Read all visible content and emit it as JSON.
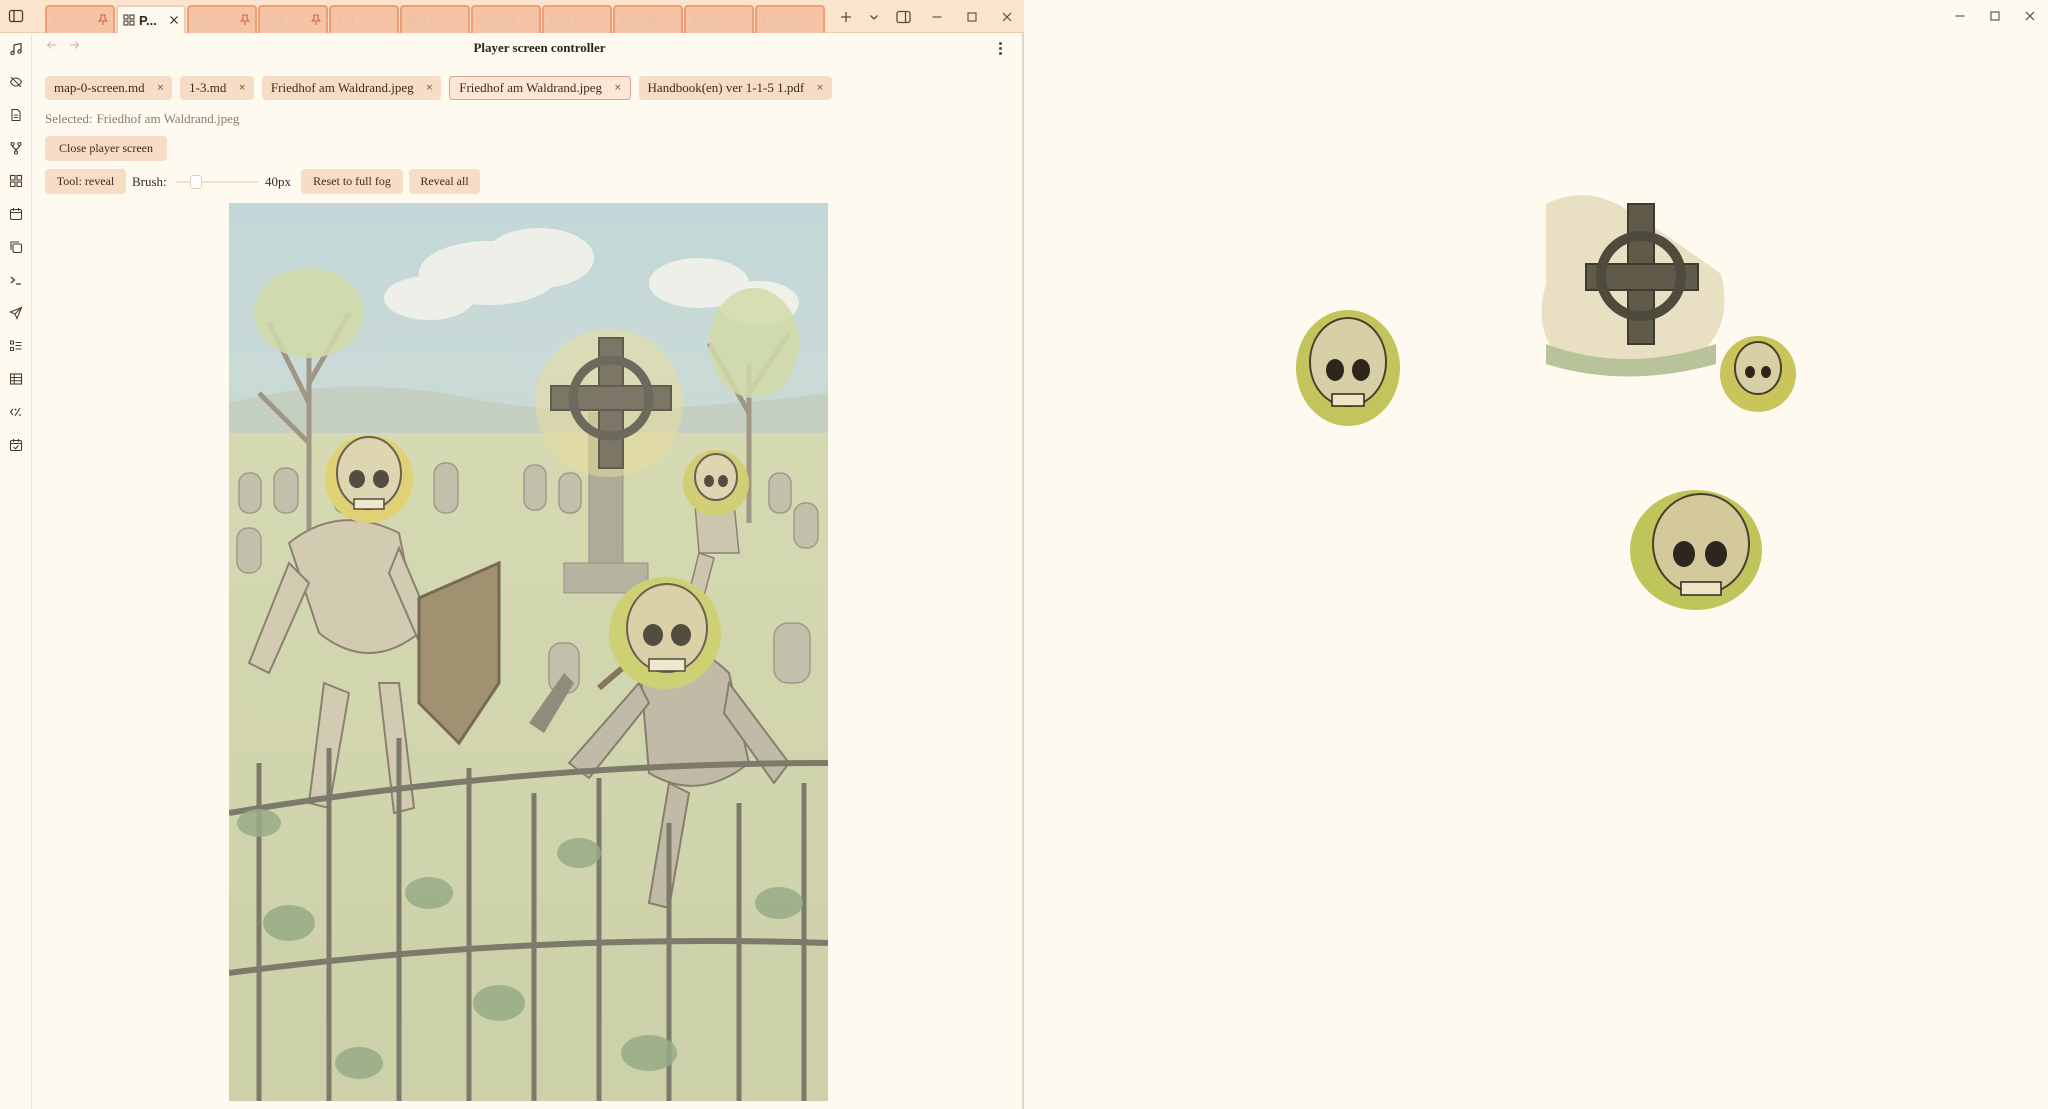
{
  "tabs": [
    {
      "label": "Kar...",
      "pinned": true,
      "active": false
    },
    {
      "label": "P...",
      "pinned": false,
      "active": true,
      "closable": true,
      "icon": "grid-icon"
    },
    {
      "label": "Sel...",
      "pinned": true,
      "active": false
    },
    {
      "label": "Sel...",
      "pinned": true,
      "active": false
    },
    {
      "label": "1-3",
      "pinned": false,
      "active": false
    },
    {
      "label": "April ...",
      "pinned": false,
      "active": false
    },
    {
      "label": "Reiseb...",
      "pinned": false,
      "active": false
    },
    {
      "label": "Flüchtl...",
      "pinned": false,
      "active": false
    },
    {
      "label": "Untitled",
      "pinned": false,
      "active": false
    },
    {
      "label": "Reiseb...",
      "pinned": false,
      "active": false
    },
    {
      "label": "Untitled",
      "pinned": false,
      "active": false
    }
  ],
  "view": {
    "title": "Player screen controller",
    "selected_label": "Selected:",
    "selected_value": "Friedhof am Waldrand.jpeg",
    "close_button": "Close player screen",
    "tool_button": "Tool: reveal",
    "brush_label": "Brush:",
    "brush_value": "40px",
    "brush_level": 0.2,
    "reset_button": "Reset to full fog",
    "reveal_button": "Reveal all"
  },
  "files": [
    {
      "label": "map-0-screen.md",
      "active": false
    },
    {
      "label": "1-3.md",
      "active": false
    },
    {
      "label": "Friedhof am Waldrand.jpeg",
      "active": false
    },
    {
      "label": "Friedhof am Waldrand.jpeg",
      "active": true
    },
    {
      "label": "Handbook(en) ver 1-1-5 1.pdf",
      "active": false
    }
  ],
  "ribbon_icons": [
    "music-note-icon",
    "eye-off-icon",
    "file-text-icon",
    "git-fork-icon",
    "grid-icon",
    "calendar-icon",
    "copy-icon",
    "terminal-icon",
    "send-icon",
    "list-checks-icon",
    "table-icon",
    "code-percent-icon",
    "calendar-check-icon"
  ],
  "colors": {
    "titlebar": "#fbe4ce",
    "tab_inactive": "#f5c3a5",
    "tab_border": "#ef9d74",
    "chip": "#f7dcc6",
    "background": "#fffaf0"
  },
  "window_controls": {
    "minimize": "—",
    "maximize": "☐",
    "close": "✕"
  }
}
